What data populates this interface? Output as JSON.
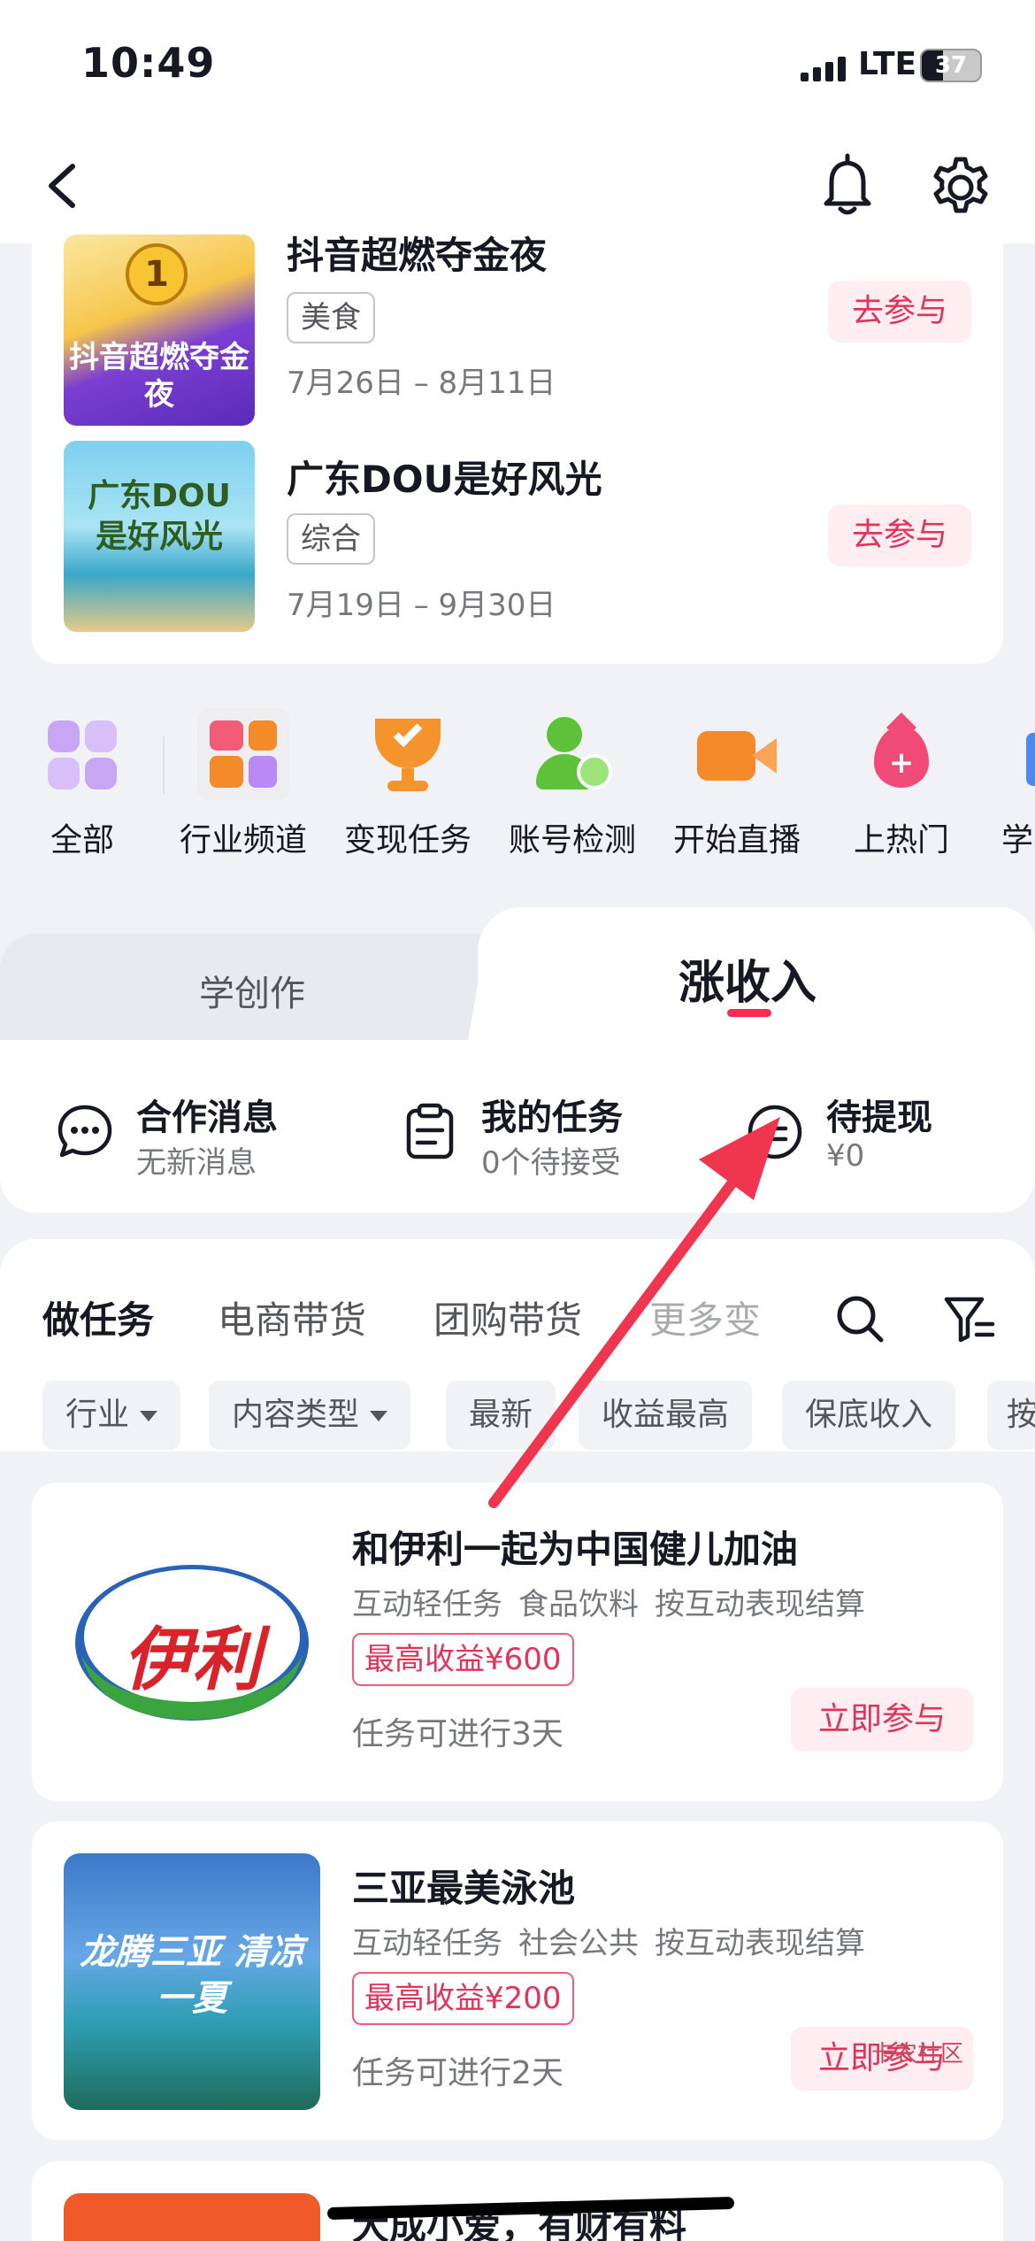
{
  "status_bar": {
    "time": "10:49",
    "network": "LTE",
    "battery": "37"
  },
  "events": [
    {
      "title": "抖音超燃夺金夜",
      "tag": "美食",
      "date": "7月26日 – 8月11日",
      "action": "去参与",
      "thumb_text": "抖音超燃夺金夜"
    },
    {
      "title": "广东DOU是好风光",
      "tag": "综合",
      "date": "7月19日 – 9月30日",
      "action": "去参与",
      "thumb_text": "广东DOU是好风光"
    }
  ],
  "quick_entries": [
    {
      "label": "全部",
      "icon": "grid-icon"
    },
    {
      "label": "行业频道",
      "icon": "channel-icon"
    },
    {
      "label": "变现任务",
      "icon": "trophy-icon"
    },
    {
      "label": "账号检测",
      "icon": "account-check-icon"
    },
    {
      "label": "开始直播",
      "icon": "video-camera-icon"
    },
    {
      "label": "上热门",
      "icon": "hot-drop-icon"
    },
    {
      "label": "学",
      "icon": "learn-icon"
    }
  ],
  "tabs": {
    "left": "学创作",
    "right": "涨收入"
  },
  "stats": [
    {
      "title": "合作消息",
      "sub": "无新消息",
      "icon": "chat-bubble-icon"
    },
    {
      "title": "我的任务",
      "sub": "0个待接受",
      "icon": "clipboard-icon"
    },
    {
      "title": "待提现",
      "sub": "¥0",
      "icon": "wallet-icon"
    }
  ],
  "task_tabs": [
    "做任务",
    "电商带货",
    "团购带货",
    "更多变"
  ],
  "filters": [
    {
      "label": "行业",
      "dropdown": true
    },
    {
      "label": "内容类型",
      "dropdown": true
    },
    {
      "label": "最新",
      "dropdown": false
    },
    {
      "label": "收益最高",
      "dropdown": false
    },
    {
      "label": "保底收入",
      "dropdown": false
    },
    {
      "label": "按",
      "dropdown": false
    }
  ],
  "tasks": [
    {
      "title": "和伊利一起为中国健儿加油",
      "tags": [
        "互动轻任务",
        "食品饮料",
        "按互动表现结算"
      ],
      "reward": "最高收益¥600",
      "duration": "任务可进行3天",
      "action": "立即参与",
      "logo_text": "伊利"
    },
    {
      "title": "三亚最美泳池",
      "tags": [
        "互动轻任务",
        "社会公共",
        "按互动表现结算"
      ],
      "reward": "最高收益¥200",
      "duration": "任务可进行2天",
      "action": "立即参与",
      "thumb_text": "龙腾三亚 清凉一夏"
    },
    {
      "title": "大成小爱，有财有料",
      "tags": [],
      "reward": "",
      "duration": "",
      "action": ""
    }
  ],
  "watermark": "卡农社区",
  "colors": {
    "accent": "#fe2c55",
    "accent_text": "#e2335a",
    "pill_bg": "#feeef1",
    "arrow": "#f0364f"
  }
}
